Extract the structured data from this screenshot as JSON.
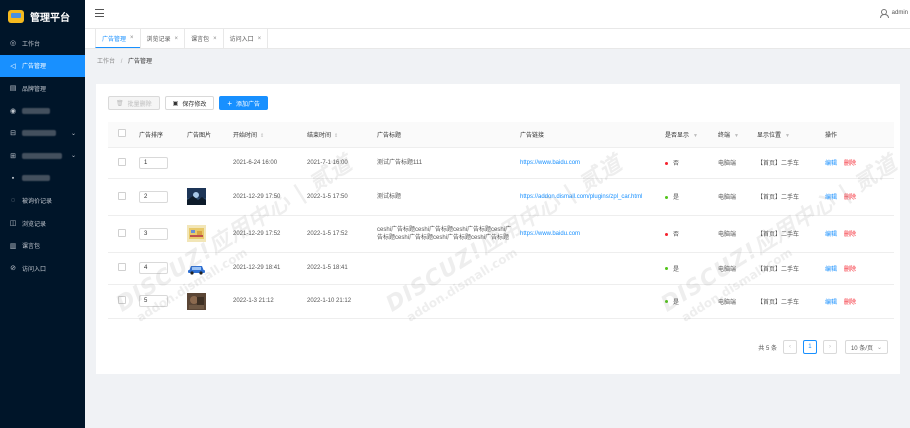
{
  "app": {
    "title": "管理平台"
  },
  "sidebar": {
    "items": [
      {
        "label": "工作台",
        "icon": "dashboard-icon",
        "active": false
      },
      {
        "label": "广告管理",
        "icon": "ad-icon",
        "active": true
      },
      {
        "label": "品牌管理",
        "icon": "brand-icon",
        "active": false
      },
      {
        "label": "",
        "icon": "location-icon",
        "active": false
      },
      {
        "label": "",
        "icon": "group-icon",
        "active": false,
        "expandable": true
      },
      {
        "label": "",
        "icon": "group2-icon",
        "active": false,
        "expandable": true
      },
      {
        "label": "",
        "icon": "item-icon",
        "active": false
      },
      {
        "label": "被询价记录",
        "icon": "inquiry-icon",
        "active": false
      },
      {
        "label": "浏览记录",
        "icon": "history-icon",
        "active": false
      },
      {
        "label": "课言包",
        "icon": "package-icon",
        "active": false
      },
      {
        "label": "访问入口",
        "icon": "entry-icon",
        "active": false
      }
    ]
  },
  "header": {
    "user": "admin"
  },
  "tabs": [
    {
      "label": "广告管理",
      "active": true
    },
    {
      "label": "浏览记录",
      "active": false
    },
    {
      "label": "课言包",
      "active": false
    },
    {
      "label": "访问入口",
      "active": false
    }
  ],
  "breadcrumb": {
    "root": "工作台",
    "current": "广告管理",
    "separator": "/"
  },
  "toolbar": {
    "batch_delete": "批量删除",
    "save_changes": "保存修改",
    "add_ad": "添加广告"
  },
  "table": {
    "columns": {
      "sort": "广告排序",
      "image": "广告图片",
      "start": "开始时间",
      "end": "结束时间",
      "title": "广告标题",
      "link": "广告链接",
      "show": "是否显示",
      "platform": "终端",
      "position": "显示位置",
      "actions": "操作"
    },
    "rows": [
      {
        "sort": "1",
        "image": "ad-thumb-blank",
        "start": "2021-6-24 16:00",
        "end": "2021-7-1 16:00",
        "title": "测试广告标题111",
        "link": "https://www.baidu.com",
        "show": "否",
        "show_color": "#f5222d",
        "platform": "电脑端",
        "position": "【首页】二手车",
        "edit": "编辑",
        "delete": "删除"
      },
      {
        "sort": "2",
        "image": "ad-thumb-landscape",
        "start": "2021-12-29 17:50",
        "end": "2022-1-5 17:50",
        "title": "测试标题",
        "link": "https://addon.dismall.com/plugins/zpl_car.html",
        "show": "是",
        "show_color": "#52c41a",
        "platform": "电脑端",
        "position": "【首页】二手车",
        "edit": "编辑",
        "delete": "删除"
      },
      {
        "sort": "3",
        "image": "ad-thumb-pixel",
        "start": "2021-12-29 17:52",
        "end": "2022-1-5 17:52",
        "title": "ceshi广告标题ceshi广告标题ceshi广告标题ceshi广告标题ceshi广告标题ceshi广告标题ceshi广告标题",
        "link": "https://www.baidu.com",
        "show": "否",
        "show_color": "#f5222d",
        "platform": "电脑端",
        "position": "【首页】二手车",
        "edit": "编辑",
        "delete": "删除"
      },
      {
        "sort": "4",
        "image": "ad-thumb-car",
        "start": "2021-12-29 18:41",
        "end": "2022-1-5 18:41",
        "title": "",
        "link": "",
        "show": "是",
        "show_color": "#52c41a",
        "platform": "电脑端",
        "position": "【首页】二手车",
        "edit": "编辑",
        "delete": "删除"
      },
      {
        "sort": "5",
        "image": "ad-thumb-photo",
        "start": "2022-1-3 21:12",
        "end": "2022-1-10 21:12",
        "title": "",
        "link": "",
        "show": "是",
        "show_color": "#52c41a",
        "platform": "电脑端",
        "position": "【首页】二手车",
        "edit": "编辑",
        "delete": "删除"
      }
    ]
  },
  "pagination": {
    "total": "共 5 条",
    "current": "1",
    "page_size": "10 条/页"
  },
  "watermark": {
    "brand": "DISCUZ!应用中心 | 贰道",
    "domain": "addon.dismall.com"
  }
}
